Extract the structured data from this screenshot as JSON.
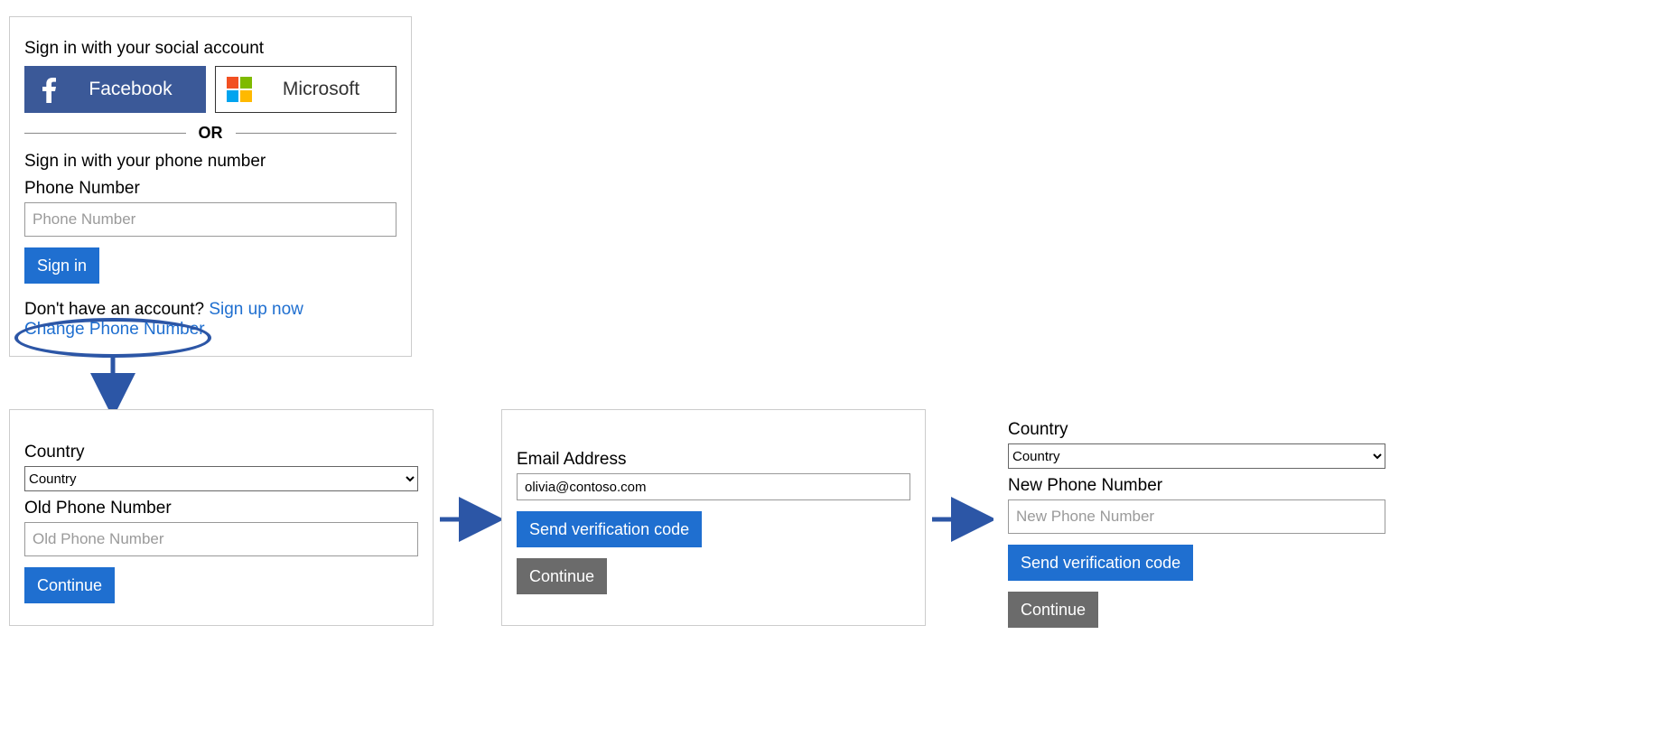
{
  "signin": {
    "social_heading": "Sign in with your social account",
    "facebook_label": "Facebook",
    "microsoft_label": "Microsoft",
    "or_text": "OR",
    "phone_heading": "Sign in with your phone number",
    "phone_label": "Phone Number",
    "phone_placeholder": "Phone Number",
    "signin_label": "Sign in",
    "footer_prompt": "Don't have an account? ",
    "signup_link": "Sign up now",
    "change_phone_link": "Change Phone Number"
  },
  "step1": {
    "country_label": "Country",
    "country_value": "Country",
    "old_phone_label": "Old Phone Number",
    "old_phone_placeholder": "Old Phone Number",
    "continue_label": "Continue"
  },
  "step2": {
    "email_label": "Email Address",
    "email_value": "olivia@contoso.com",
    "send_code_label": "Send verification code",
    "continue_label": "Continue"
  },
  "step3": {
    "country_label": "Country",
    "country_value": "Country",
    "new_phone_label": "New Phone Number",
    "new_phone_placeholder": "New Phone Number",
    "send_code_label": "Send verification code",
    "continue_label": "Continue"
  }
}
